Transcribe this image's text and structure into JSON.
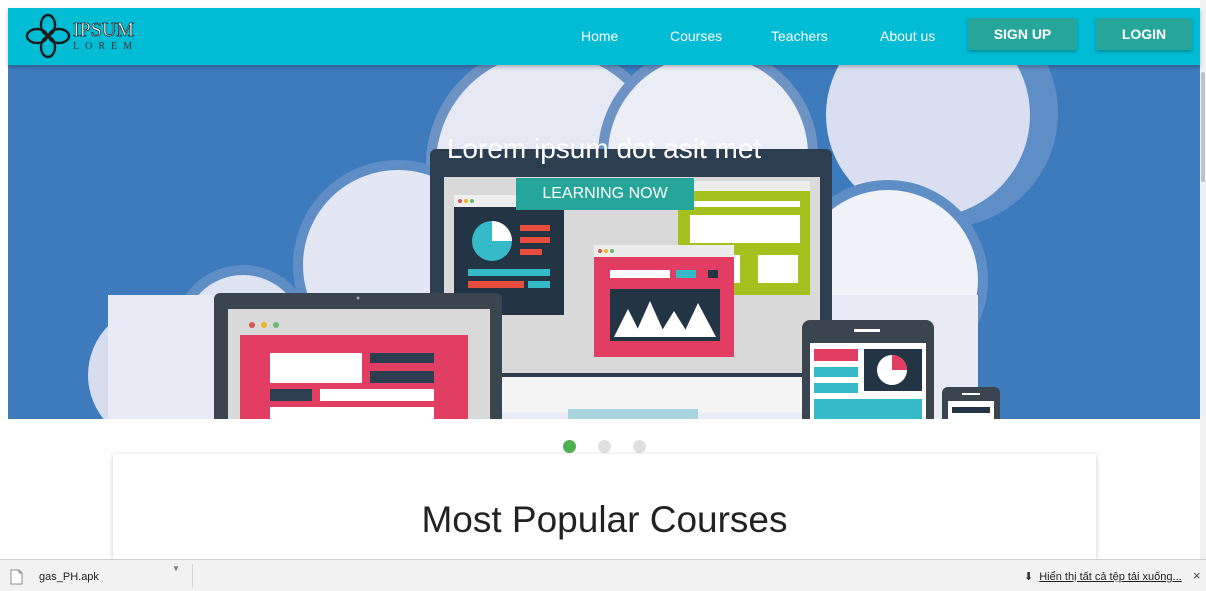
{
  "navbar": {
    "logo": {
      "main": "IPSUM",
      "sub": "LOREM"
    },
    "links": [
      "Home",
      "Courses",
      "Teachers",
      "About us"
    ],
    "signup_label": "SIGN UP",
    "login_label": "LOGIN"
  },
  "hero": {
    "title": "Lorem ipsum dot asit met",
    "cta_label": "LEARNING NOW"
  },
  "carousel": {
    "slide_count": 3,
    "active_index": 0
  },
  "section": {
    "title": "Most Popular Courses"
  },
  "downloads": {
    "file_name": "gas_PH.apk",
    "show_all_label": "Hiển thị tất cả tệp tải xuống...",
    "close_symbol": "×"
  },
  "colors": {
    "navbar": "#00bcd4",
    "button": "#26a69a",
    "hero_bg": "#3d7bbd",
    "dot_active": "#4caf50",
    "dot_inactive": "#e0e0e0"
  }
}
